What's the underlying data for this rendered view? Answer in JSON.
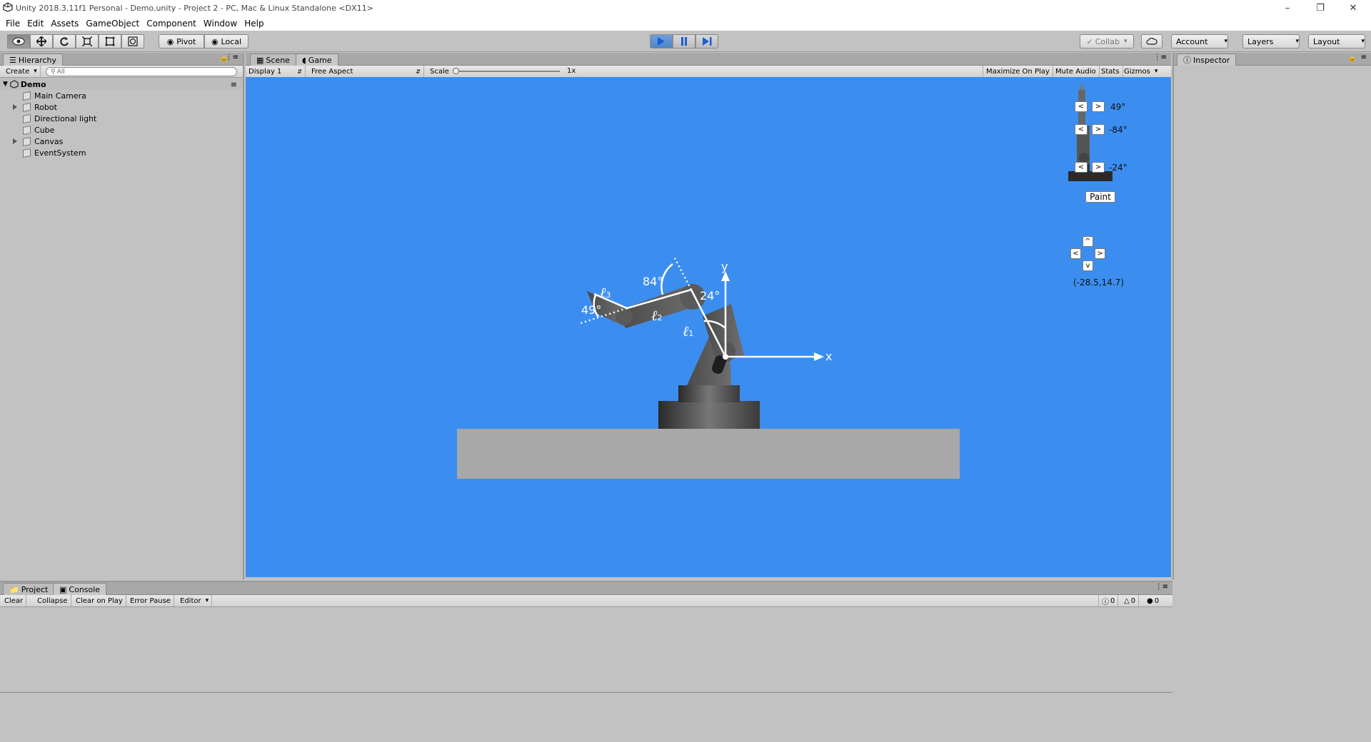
{
  "window": {
    "title": "Unity 2018.3.11f1 Personal - Demo.unity - Project 2 - PC, Mac & Linux Standalone <DX11>"
  },
  "menu": [
    "File",
    "Edit",
    "Assets",
    "GameObject",
    "Component",
    "Window",
    "Help"
  ],
  "toolbar": {
    "pivot": "Pivot",
    "local": "Local",
    "collab": "Collab",
    "account": "Account",
    "layers": "Layers",
    "layout": "Layout"
  },
  "hierarchy": {
    "tab": "Hierarchy",
    "create": "Create",
    "search_placeholder": "All",
    "scene": "Demo",
    "items": [
      "Main Camera",
      "Robot",
      "Directional light",
      "Cube",
      "Canvas",
      "EventSystem"
    ]
  },
  "game_panel": {
    "tabs": [
      "Scene",
      "Game"
    ],
    "display": "Display 1",
    "aspect": "Free Aspect",
    "scale_label": "Scale",
    "scale_value": "1x",
    "options": [
      "Maximize On Play",
      "Mute Audio",
      "Stats",
      "Gizmos"
    ]
  },
  "game_ui": {
    "joints": [
      "49°",
      "-84°",
      "-24°"
    ],
    "left_btn": "<",
    "right_btn": ">",
    "paint": "Paint",
    "up": "^",
    "down": "v",
    "position": "(-28.5,14.7)"
  },
  "diagram": {
    "angle1": "49°",
    "angle2": "84°",
    "angle3": "24°",
    "l_symbol": "ℓ",
    "l1_sub": "1",
    "l2_sub": "2",
    "l3_sub": "3",
    "x_axis": "x",
    "y_axis": "y"
  },
  "inspector": {
    "tab": "Inspector"
  },
  "bottom": {
    "tabs": [
      "Project",
      "Console"
    ],
    "buttons": [
      "Clear",
      "Collapse",
      "Clear on Play",
      "Error Pause",
      "Editor"
    ],
    "counts": [
      "0",
      "0",
      "0"
    ]
  },
  "colors": {
    "game_bg": "#3b8ef0",
    "play_active": "#4f86c8"
  }
}
